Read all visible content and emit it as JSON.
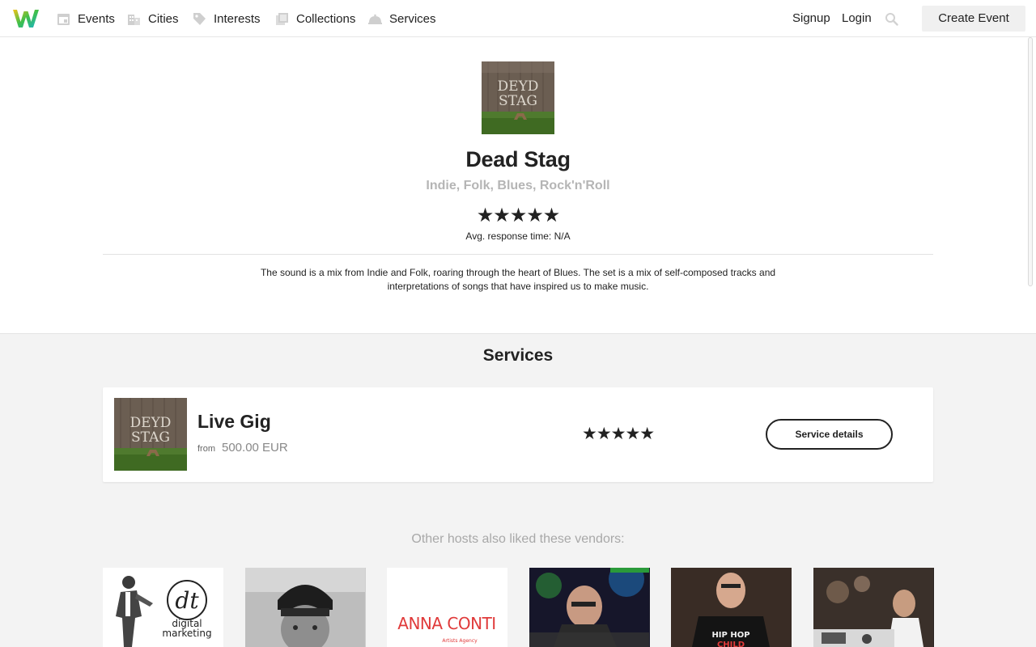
{
  "nav": {
    "items": [
      {
        "label": "Events",
        "icon": "calendar-icon"
      },
      {
        "label": "Cities",
        "icon": "building-icon"
      },
      {
        "label": "Interests",
        "icon": "tag-icon"
      },
      {
        "label": "Collections",
        "icon": "collection-icon"
      },
      {
        "label": "Services",
        "icon": "cloche-icon"
      }
    ],
    "signup": "Signup",
    "login": "Login",
    "create": "Create Event"
  },
  "vendor": {
    "name": "Dead Stag",
    "genres": "Indie, Folk, Blues, Rock'n'Roll",
    "stars": "★★★★★",
    "rating": 5,
    "response": "Avg. response time: N/A",
    "description": "The sound is a mix from Indie and Folk, roaring through the heart of Blues. The set is a mix of self-composed tracks and interpretations of songs that have inspired us to make music.",
    "logo_text_line1": "DEYD",
    "logo_text_line2": "STAG"
  },
  "services": {
    "title": "Services",
    "items": [
      {
        "name": "Live Gig",
        "from": "from",
        "price": "500.00 EUR",
        "stars": "★★★★★",
        "rating": 5,
        "button": "Service details"
      }
    ]
  },
  "liked": {
    "title": "Other hosts also liked these vendors:",
    "vendors": [
      {
        "kind": "dt-digital-marketing",
        "text_line1": "dt",
        "text_line2": "digital",
        "text_line3": "marketing"
      },
      {
        "kind": "beanie-portrait"
      },
      {
        "kind": "anna-conti",
        "text_line1": "ANNA CONTI",
        "text_line2": "Artists Agency"
      },
      {
        "kind": "dj-club"
      },
      {
        "kind": "hiphop-portrait",
        "text_line1": "HIP HOP",
        "text_line2": "CHILD"
      },
      {
        "kind": "dj-party"
      }
    ]
  },
  "colors": {
    "accent_green": "#3fbf4a",
    "accent_teal": "#1ab3c9",
    "anna_red": "#e03a3a"
  }
}
